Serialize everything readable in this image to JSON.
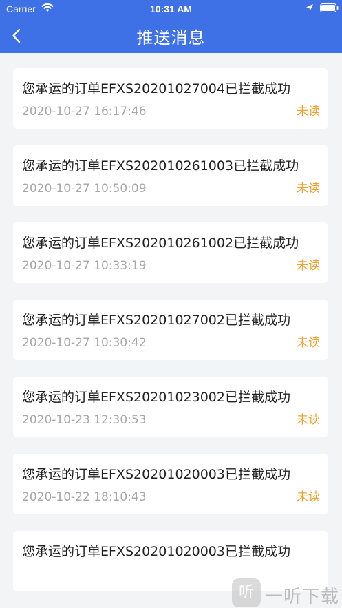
{
  "status_bar": {
    "carrier": "Carrier",
    "time": "10:31 AM"
  },
  "nav": {
    "title": "推送消息",
    "back_icon": "chevron-left-icon"
  },
  "messages": [
    {
      "title": "您承运的订单EFXS20201027004已拦截成功",
      "time": "2020-10-27 16:17:46",
      "status": "未读"
    },
    {
      "title": "您承运的订单EFXS202010261003已拦截成功",
      "time": "2020-10-27 10:50:09",
      "status": "未读"
    },
    {
      "title": "您承运的订单EFXS202010261002已拦截成功",
      "time": "2020-10-27 10:33:19",
      "status": "未读"
    },
    {
      "title": "您承运的订单EFXS20201027002已拦截成功",
      "time": "2020-10-27 10:30:42",
      "status": "未读"
    },
    {
      "title": "您承运的订单EFXS20201023002已拦截成功",
      "time": "2020-10-23 12:30:53",
      "status": "未读"
    },
    {
      "title": "您承运的订单EFXS20201020003已拦截成功",
      "time": "2020-10-22 18:10:43",
      "status": "未读"
    },
    {
      "title": "您承运的订单EFXS20201020003已拦截成功",
      "time": "",
      "status": ""
    }
  ],
  "watermark": {
    "logo": "听",
    "text": "一听下载"
  },
  "colors": {
    "header": "#3f71e6",
    "unread": "#f0a130",
    "time": "#a7a7a7"
  }
}
